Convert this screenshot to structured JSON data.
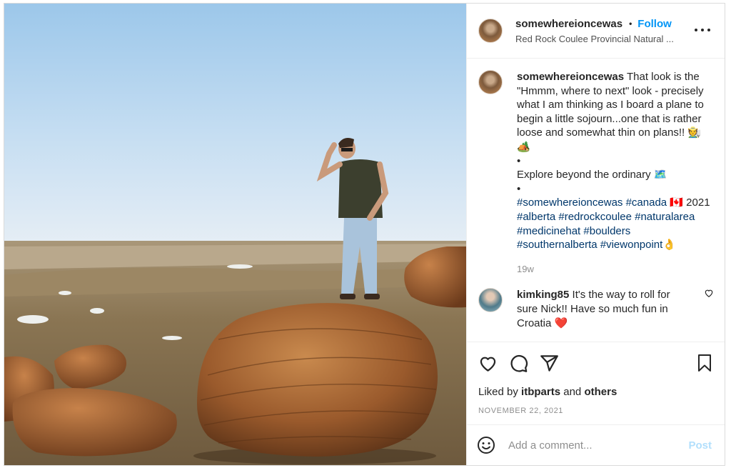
{
  "post": {
    "author": "somewhereioncewas",
    "separator": "•",
    "follow_label": "Follow",
    "location": "Red Rock Coulee Provincial Natural ...",
    "more_icon": "more-horizontal-icon"
  },
  "caption": {
    "author": "somewhereioncewas",
    "line1": "That look is the \"Hmmm, where to next\" look - precisely what I am thinking as I board a plane to begin a little sojourn...one that is rather loose and somewhat thin on plans!! 🧑‍🌾🏕️",
    "bullet1": "•",
    "line2": "Explore beyond the ordinary 🗺️",
    "bullet2": "•",
    "tags_a": "#somewhereioncewas #canada",
    "flag": "🇨🇦",
    "year": "2021",
    "tags_b": "#alberta #redrockcoulee #naturalarea #medicinehat #boulders #southernalberta #viewonpoint",
    "tags_b_emoji": "👌",
    "age": "19w"
  },
  "comment": {
    "author": "kimking85",
    "text": "It's the way to roll for sure Nick!! Have so much fun in Croatia",
    "emoji": "❤️"
  },
  "actions": {
    "liked_prefix": "Liked by",
    "liked_user": "itbparts",
    "liked_and": "and",
    "liked_others": "others",
    "date": "NOVEMBER 22, 2021"
  },
  "composer": {
    "placeholder": "Add a comment...",
    "post_label": "Post"
  },
  "colors": {
    "link_blue": "#0095f6",
    "hashtag": "#00376b",
    "post_disabled": "#b2dffc",
    "muted": "#8e8e8e"
  }
}
